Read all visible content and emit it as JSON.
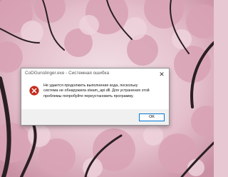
{
  "dialog": {
    "title": "CoDGunslinger.exe - Системная ошибка",
    "close_glyph": "✕",
    "icon": "error-icon",
    "message_lines": [
      "Не удается продолжить выполнение кода, поскольку",
      "система не обнаружила steam_api.dll. Для устранения этой",
      "проблемы попробуйте переустановить программу."
    ],
    "ok_label": "OK"
  },
  "colors": {
    "accent": "#0078d7",
    "error_red": "#c42b1c"
  }
}
